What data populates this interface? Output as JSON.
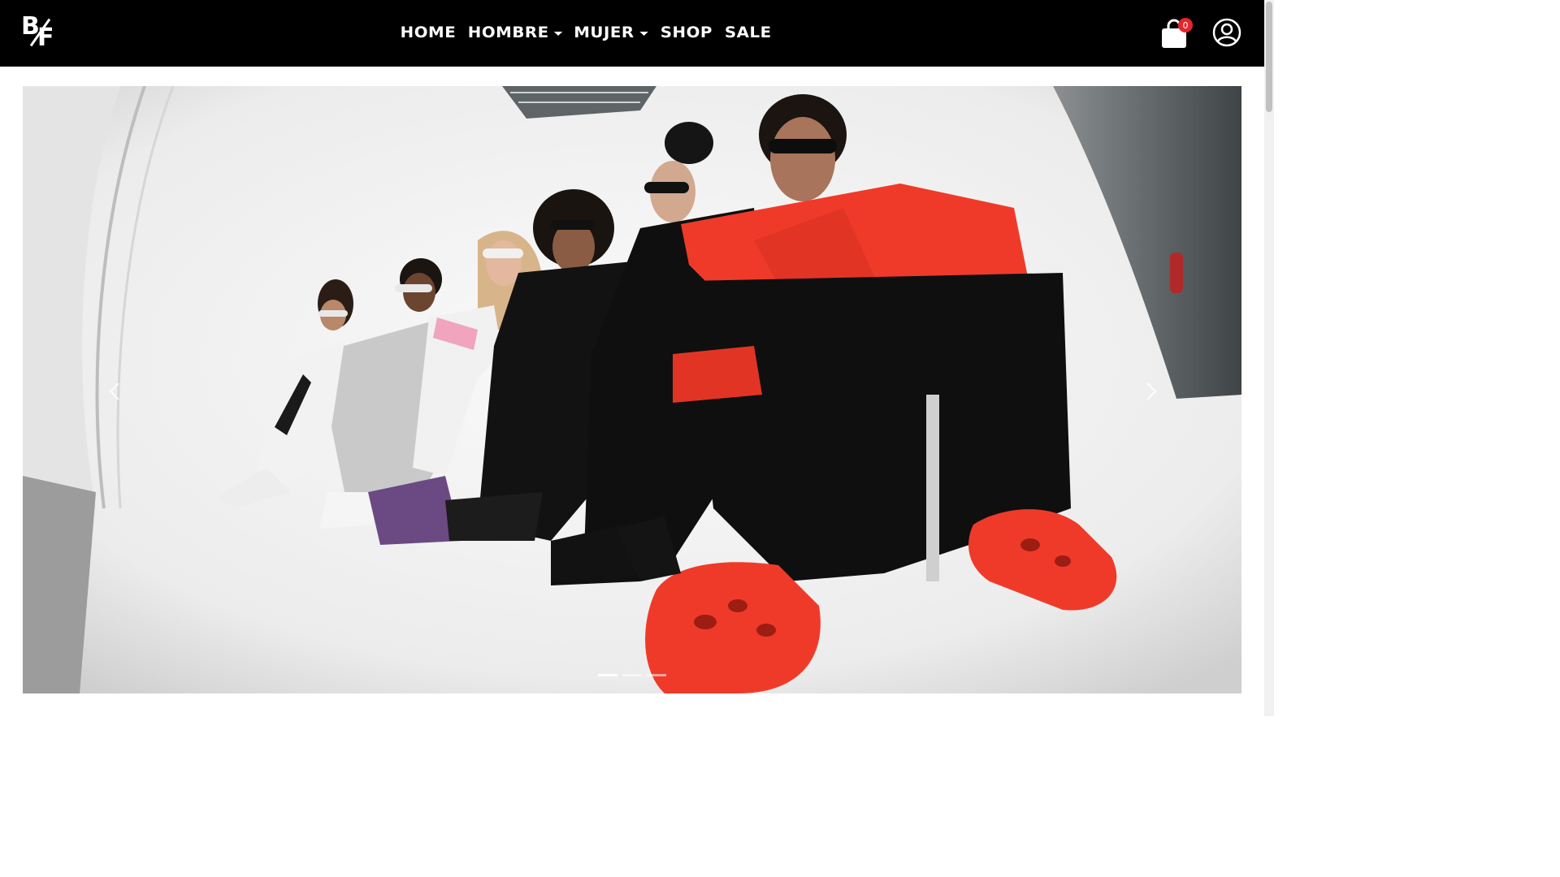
{
  "navbar": {
    "logo_text": "BF",
    "logo_b": "B",
    "logo_f": "F",
    "menu": [
      {
        "label": "HOME",
        "has_dropdown": false
      },
      {
        "label": "HOMBRE",
        "has_dropdown": true
      },
      {
        "label": "MUJER",
        "has_dropdown": true
      },
      {
        "label": "SHOP",
        "has_dropdown": false
      },
      {
        "label": "SALE",
        "has_dropdown": false
      }
    ],
    "cart_count": "0",
    "cart_icon": "shopping-bag-icon",
    "user_icon": "user-circle-icon"
  },
  "hero": {
    "slide_count": 3,
    "active_slide": 1,
    "prev_icon": "chevron-left-icon",
    "next_icon": "chevron-right-icon"
  },
  "colors": {
    "nav_bg": "#000000",
    "badge": "#e3262b",
    "accent_red": "#ef3a2a"
  }
}
